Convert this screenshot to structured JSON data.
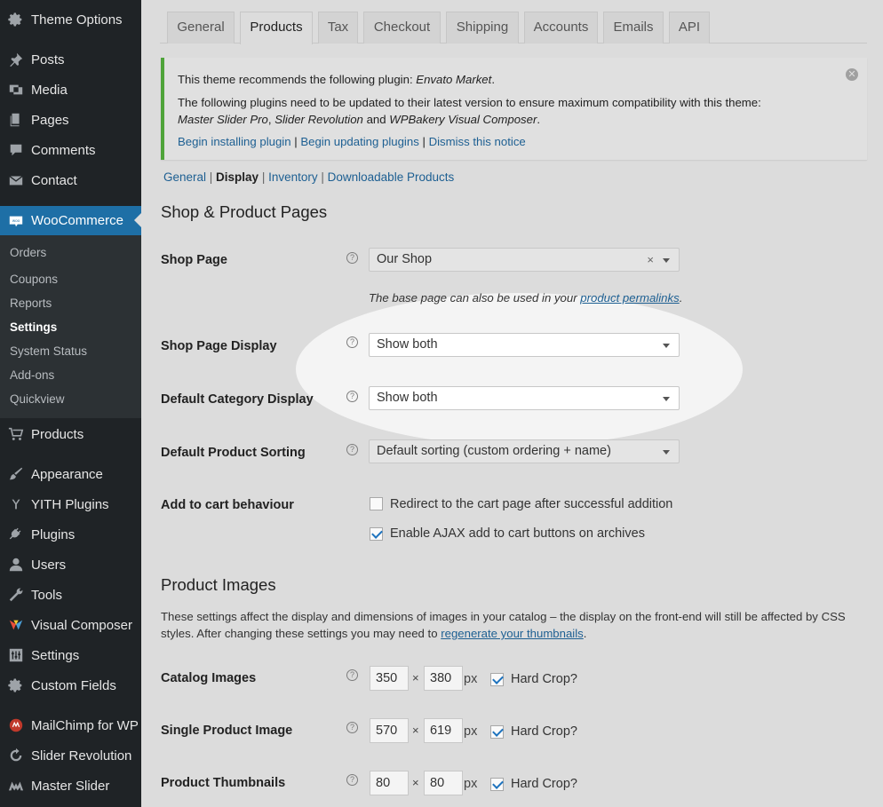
{
  "sidebar": {
    "items": [
      {
        "label": "Theme Options",
        "icon": "gear-icon"
      },
      {
        "label": "Posts",
        "icon": "pin-icon"
      },
      {
        "label": "Media",
        "icon": "media-icon"
      },
      {
        "label": "Pages",
        "icon": "pages-icon"
      },
      {
        "label": "Comments",
        "icon": "comment-icon"
      },
      {
        "label": "Contact",
        "icon": "mail-icon"
      },
      {
        "label": "WooCommerce",
        "icon": "woo-icon"
      },
      {
        "label": "Products",
        "icon": "cart-icon"
      },
      {
        "label": "Appearance",
        "icon": "brush-icon"
      },
      {
        "label": "YITH Plugins",
        "icon": "yith-icon"
      },
      {
        "label": "Plugins",
        "icon": "plug-icon"
      },
      {
        "label": "Users",
        "icon": "user-icon"
      },
      {
        "label": "Tools",
        "icon": "wrench-icon"
      },
      {
        "label": "Visual Composer",
        "icon": "vc-icon"
      },
      {
        "label": "Settings",
        "icon": "settings-icon"
      },
      {
        "label": "Custom Fields",
        "icon": "gear-icon"
      },
      {
        "label": "MailChimp for WP",
        "icon": "mailchimp-icon"
      },
      {
        "label": "Slider Revolution",
        "icon": "refresh-icon"
      },
      {
        "label": "Master Slider",
        "icon": "ms-icon"
      }
    ],
    "submenu": [
      "Orders",
      "Coupons",
      "Reports",
      "Settings",
      "System Status",
      "Add-ons",
      "Quickview"
    ]
  },
  "tabs": [
    "General",
    "Products",
    "Tax",
    "Checkout",
    "Shipping",
    "Accounts",
    "Emails",
    "API"
  ],
  "notice": {
    "line1_prefix": "This theme recommends the following plugin: ",
    "line1_plugin": "Envato Market",
    "line1_suffix": ".",
    "line2": "The following plugins need to be updated to their latest version to ensure maximum compatibility with this theme:",
    "line3_a": "Master Slider Pro",
    "line3_sep1": ", ",
    "line3_b": "Slider Revolution",
    "line3_and": " and ",
    "line3_c": "WPBakery Visual Composer",
    "line3_end": ".",
    "link_install": "Begin installing plugin",
    "link_update": "Begin updating plugins",
    "link_dismiss": "Dismiss this notice",
    "sep": " | "
  },
  "subnav": {
    "items": [
      "General",
      "Display",
      "Inventory",
      "Downloadable Products"
    ],
    "sep": " | "
  },
  "shop": {
    "heading": "Shop & Product Pages",
    "shop_page_label": "Shop Page",
    "shop_page_value": "Our Shop",
    "shop_page_clear": "×",
    "desc_prefix": "The base page can also be used in your ",
    "desc_link": "product permalinks",
    "desc_suffix": ".",
    "display_label": "Shop Page Display",
    "display_value": "Show both",
    "category_label": "Default Category Display",
    "category_value": "Show both",
    "sorting_label": "Default Product Sorting",
    "sorting_value": "Default sorting (custom ordering + name)",
    "cart_label": "Add to cart behaviour",
    "cart_redirect": "Redirect to the cart page after successful addition",
    "cart_redirect_checked": false,
    "cart_ajax": "Enable AJAX add to cart buttons on archives",
    "cart_ajax_checked": true
  },
  "images": {
    "heading": "Product Images",
    "desc_a": "These settings affect the display and dimensions of images in your catalog – the display on the front-end will still be affected by CSS",
    "desc_b": "styles. After changing these settings you may need to ",
    "desc_link": "regenerate your thumbnails",
    "desc_end": ".",
    "times": "×",
    "px": "px",
    "hard_crop": "Hard Crop?",
    "rows": [
      {
        "label": "Catalog Images",
        "width": "350",
        "height": "380",
        "hard_crop": true
      },
      {
        "label": "Single Product Image",
        "width": "570",
        "height": "619",
        "hard_crop": true
      },
      {
        "label": "Product Thumbnails",
        "width": "80",
        "height": "80",
        "hard_crop": true
      }
    ]
  },
  "help_glyph": "?",
  "colors": {
    "accent": "#1e6fa6",
    "notice_border": "#4fa43a",
    "link": "#1d5f92",
    "sidebar": "#1f2326"
  }
}
